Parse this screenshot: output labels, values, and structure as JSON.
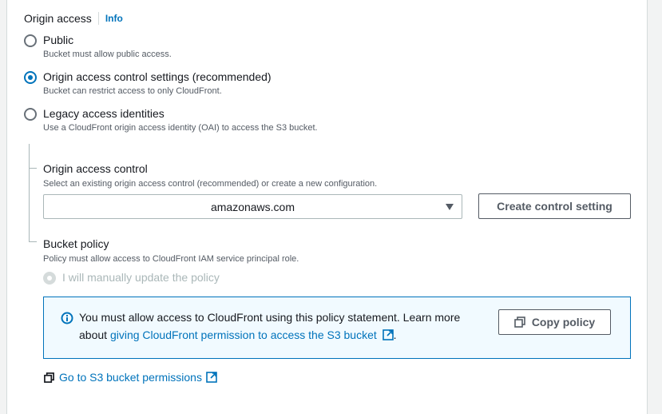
{
  "origin_access": {
    "title": "Origin access",
    "info": "Info",
    "options": [
      {
        "label": "Public",
        "description": "Bucket must allow public access.",
        "selected": false
      },
      {
        "label": "Origin access control settings (recommended)",
        "description": "Bucket can restrict access to only CloudFront.",
        "selected": true
      },
      {
        "label": "Legacy access identities",
        "description": "Use a CloudFront origin access identity (OAI) to access the S3 bucket.",
        "selected": false
      }
    ]
  },
  "oac": {
    "title": "Origin access control",
    "description": "Select an existing origin access control (recommended) or create a new configuration.",
    "selected_value": "amazonaws.com",
    "create_button": "Create control setting"
  },
  "bucket_policy": {
    "title": "Bucket policy",
    "description": "Policy must allow access to CloudFront IAM service principal role.",
    "option_label": "I will manually update the policy"
  },
  "alert": {
    "text_1": "You must allow access to CloudFront using this policy statement. Learn more",
    "text_2": "about",
    "link_text": "giving CloudFront permission to access the S3 bucket",
    "text_end": ".",
    "copy_button": "Copy policy"
  },
  "s3_permissions_link": "Go to S3 bucket permissions",
  "colors": {
    "accent": "#0073bb",
    "alert_bg": "#f1faff",
    "text": "#16191f",
    "secondary_text": "#545b64"
  }
}
